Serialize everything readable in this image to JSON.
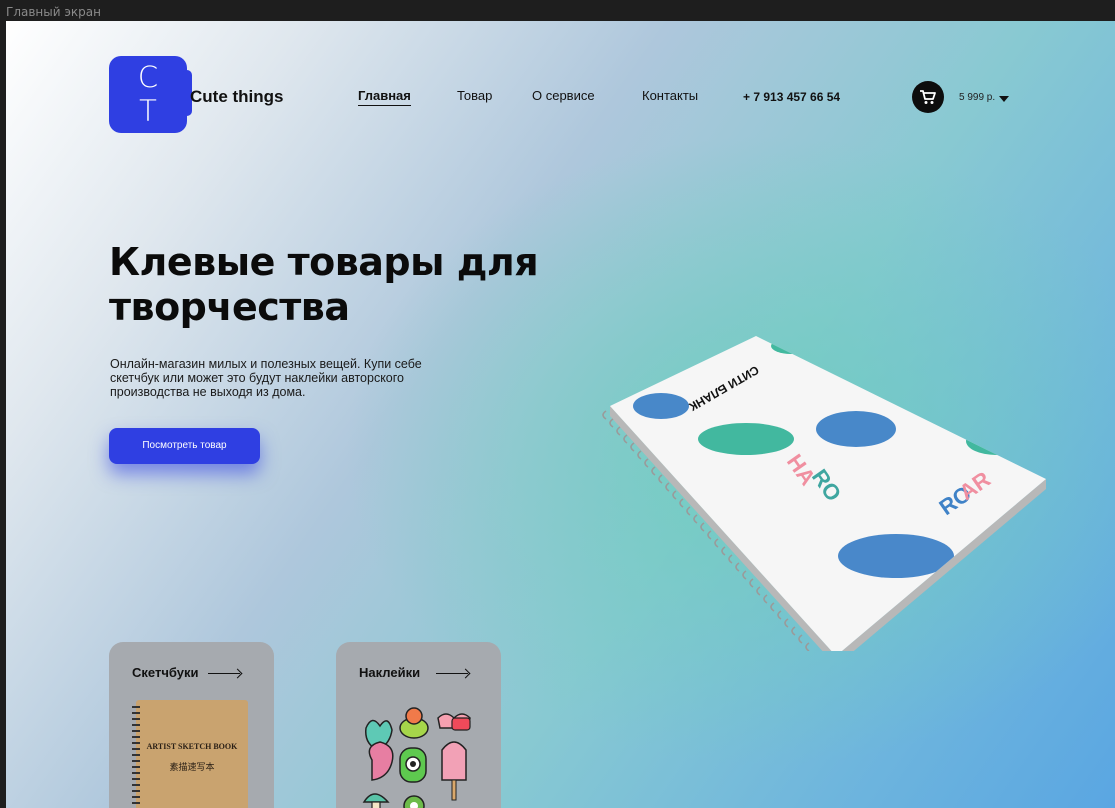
{
  "frame_label": "Главный экран",
  "logo": {
    "letter_top": "C",
    "letter_bottom": "T",
    "brand": "Cute things"
  },
  "nav": {
    "items": [
      {
        "label": "Главная",
        "active": true
      },
      {
        "label": "Товар",
        "active": false
      },
      {
        "label": "О сервисе",
        "active": false
      },
      {
        "label": "Контакты",
        "active": false
      }
    ],
    "phone": "+ 7 913 457 66 54",
    "cart_total": "5 999 р."
  },
  "hero": {
    "title": "Клевые товары  для творчества",
    "description": "Онлайн-магазин милых  и полезных вещей. Купи себе скетчбук или может это будут наклейки авторского производства не выходя из дома.",
    "cta_label": "Посмотреть товар"
  },
  "cards": [
    {
      "title": "Скетчбуки",
      "image": "artist-sketch-book"
    },
    {
      "title": "Наклейки",
      "image": "stickers"
    }
  ],
  "sketchbook_cover": {
    "line1": "ARTIST SKETCH BOOK",
    "line3": "素描速写本"
  },
  "colors": {
    "accent": "#2f3fe2",
    "dark": "#0d0d0d",
    "card_bg": "#a6aaaf"
  }
}
